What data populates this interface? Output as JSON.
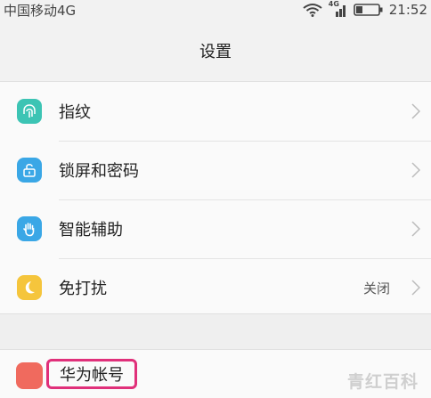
{
  "status_bar": {
    "carrier": "中国移动4G",
    "network_tag": "4G",
    "time": "21:52"
  },
  "header": {
    "title": "设置"
  },
  "settings_items": [
    {
      "label": "指纹",
      "icon": "fingerprint-icon",
      "icon_color": "#3cc4b4",
      "value": ""
    },
    {
      "label": "锁屏和密码",
      "icon": "lock-icon",
      "icon_color": "#3aa7e6",
      "value": ""
    },
    {
      "label": "智能辅助",
      "icon": "hand-icon",
      "icon_color": "#3aa7e6",
      "value": ""
    },
    {
      "label": "免打扰",
      "icon": "moon-icon",
      "icon_color": "#f5c53c",
      "value": "关闭"
    }
  ],
  "account": {
    "label": "华为帐号",
    "icon": "huawei-account-icon",
    "icon_color": "#f06a5e",
    "highlight_color": "#e0307a"
  },
  "watermark": "青红百科"
}
